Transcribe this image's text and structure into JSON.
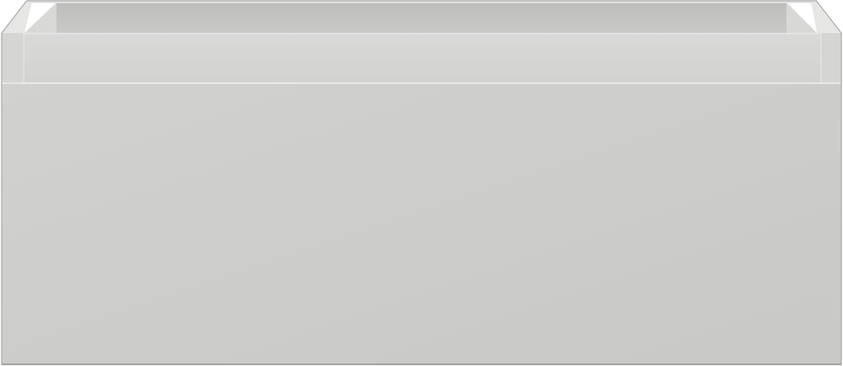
{
  "scene": {
    "subject": "drawer-cabinet",
    "colors": {
      "background": "#ffffff",
      "body": "#d2d2d1",
      "front": "#cfcfcd",
      "interior": "#c2c2c1",
      "rim": "#d6d6d5",
      "edge_light": "#e4e4e3",
      "shadow": "#9a9a99"
    }
  }
}
